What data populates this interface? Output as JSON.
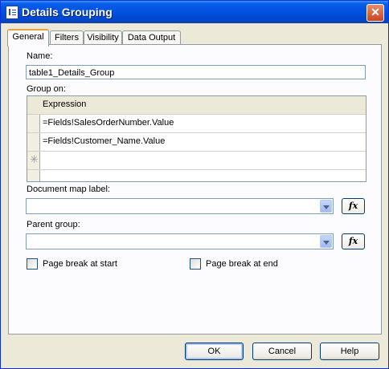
{
  "window": {
    "title": "Details Grouping",
    "close_label": "✕"
  },
  "tabs": [
    {
      "label": "General"
    },
    {
      "label": "Filters"
    },
    {
      "label": "Visibility"
    },
    {
      "label": "Data Output"
    }
  ],
  "general": {
    "name_label": "Name:",
    "name_value": "table1_Details_Group",
    "group_on_label": "Group on:",
    "grid": {
      "header": "Expression",
      "rows": [
        "=Fields!SalesOrderNumber.Value",
        "=Fields!Customer_Name.Value"
      ],
      "new_row_marker": "✳"
    },
    "doc_map_label": "Document map label:",
    "doc_map_value": "",
    "parent_group_label": "Parent group:",
    "parent_group_value": "",
    "fx_label": "fx",
    "page_break_start": {
      "label": "Page break at start",
      "checked": false
    },
    "page_break_end": {
      "label": "Page break at end",
      "checked": false
    }
  },
  "buttons": {
    "ok": "OK",
    "cancel": "Cancel",
    "help": "Help"
  }
}
